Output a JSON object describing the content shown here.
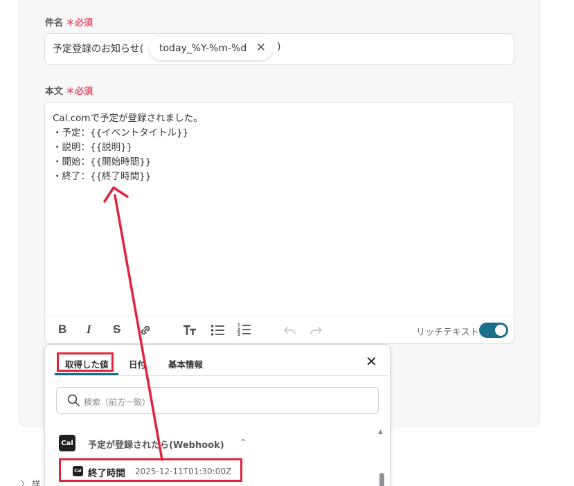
{
  "subject": {
    "label": "件名",
    "required_mark": "＊必須",
    "prefix_text": "予定登録のお知らせ(",
    "chip_text": "today_%Y-%m-%d",
    "chip_close": "✕",
    "suffix_text": ")"
  },
  "body": {
    "label": "本文",
    "required_mark": "＊必須",
    "lines": [
      "Cal.comで予定が登録されました。",
      "・予定：{{イベントタイトル}}",
      "・説明：{{説明}}",
      "・開始：{{開始時間}}",
      "・終了：{{終了時間}}"
    ]
  },
  "toolbar": {
    "bold": "B",
    "italic": "I",
    "strike": "S",
    "link_icon": "link-icon",
    "text_size_icon": "text-size-icon",
    "bullet_list_icon": "bullet-list-icon",
    "numbered_list_icon": "numbered-list-icon",
    "undo_icon": "undo-icon",
    "redo_icon": "redo-icon",
    "rich_text_label": "リッチテキスト",
    "rich_text_enabled": true
  },
  "popup": {
    "tabs": [
      {
        "label": "取得した値",
        "active": true
      },
      {
        "label": "日付",
        "active": false
      },
      {
        "label": "基本情報",
        "active": false
      }
    ],
    "close": "✕",
    "search_placeholder": "検索（前方一致）",
    "source": {
      "logo": "Cal",
      "title": "予定が登録されたら(Webhook)",
      "caret": "⌃"
    },
    "item": {
      "logo": "Cal",
      "name": "終了時間",
      "value": "2025-12-11T01:30:00Z"
    }
  },
  "footer": {
    "detail_chevron": "〉",
    "detail_text": "詳"
  },
  "colors": {
    "accent": "#1a6e8c",
    "required": "#e9546b",
    "annotation": "#e2243b"
  }
}
